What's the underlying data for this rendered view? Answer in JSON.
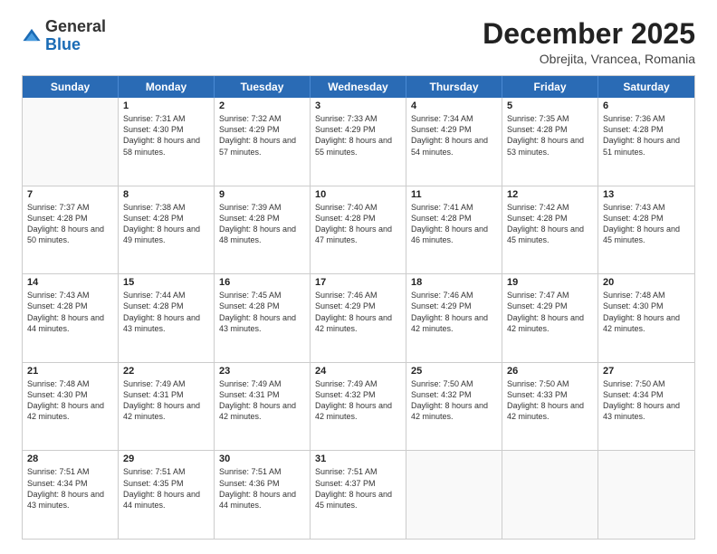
{
  "logo": {
    "general": "General",
    "blue": "Blue"
  },
  "header": {
    "month": "December 2025",
    "location": "Obrejita, Vrancea, Romania"
  },
  "days_of_week": [
    "Sunday",
    "Monday",
    "Tuesday",
    "Wednesday",
    "Thursday",
    "Friday",
    "Saturday"
  ],
  "weeks": [
    [
      {
        "day": "",
        "empty": true
      },
      {
        "day": "1",
        "sunrise": "7:31 AM",
        "sunset": "4:30 PM",
        "daylight": "8 hours and 58 minutes."
      },
      {
        "day": "2",
        "sunrise": "7:32 AM",
        "sunset": "4:29 PM",
        "daylight": "8 hours and 57 minutes."
      },
      {
        "day": "3",
        "sunrise": "7:33 AM",
        "sunset": "4:29 PM",
        "daylight": "8 hours and 55 minutes."
      },
      {
        "day": "4",
        "sunrise": "7:34 AM",
        "sunset": "4:29 PM",
        "daylight": "8 hours and 54 minutes."
      },
      {
        "day": "5",
        "sunrise": "7:35 AM",
        "sunset": "4:28 PM",
        "daylight": "8 hours and 53 minutes."
      },
      {
        "day": "6",
        "sunrise": "7:36 AM",
        "sunset": "4:28 PM",
        "daylight": "8 hours and 51 minutes."
      }
    ],
    [
      {
        "day": "7",
        "sunrise": "7:37 AM",
        "sunset": "4:28 PM",
        "daylight": "8 hours and 50 minutes."
      },
      {
        "day": "8",
        "sunrise": "7:38 AM",
        "sunset": "4:28 PM",
        "daylight": "8 hours and 49 minutes."
      },
      {
        "day": "9",
        "sunrise": "7:39 AM",
        "sunset": "4:28 PM",
        "daylight": "8 hours and 48 minutes."
      },
      {
        "day": "10",
        "sunrise": "7:40 AM",
        "sunset": "4:28 PM",
        "daylight": "8 hours and 47 minutes."
      },
      {
        "day": "11",
        "sunrise": "7:41 AM",
        "sunset": "4:28 PM",
        "daylight": "8 hours and 46 minutes."
      },
      {
        "day": "12",
        "sunrise": "7:42 AM",
        "sunset": "4:28 PM",
        "daylight": "8 hours and 45 minutes."
      },
      {
        "day": "13",
        "sunrise": "7:43 AM",
        "sunset": "4:28 PM",
        "daylight": "8 hours and 45 minutes."
      }
    ],
    [
      {
        "day": "14",
        "sunrise": "7:43 AM",
        "sunset": "4:28 PM",
        "daylight": "8 hours and 44 minutes."
      },
      {
        "day": "15",
        "sunrise": "7:44 AM",
        "sunset": "4:28 PM",
        "daylight": "8 hours and 43 minutes."
      },
      {
        "day": "16",
        "sunrise": "7:45 AM",
        "sunset": "4:28 PM",
        "daylight": "8 hours and 43 minutes."
      },
      {
        "day": "17",
        "sunrise": "7:46 AM",
        "sunset": "4:29 PM",
        "daylight": "8 hours and 42 minutes."
      },
      {
        "day": "18",
        "sunrise": "7:46 AM",
        "sunset": "4:29 PM",
        "daylight": "8 hours and 42 minutes."
      },
      {
        "day": "19",
        "sunrise": "7:47 AM",
        "sunset": "4:29 PM",
        "daylight": "8 hours and 42 minutes."
      },
      {
        "day": "20",
        "sunrise": "7:48 AM",
        "sunset": "4:30 PM",
        "daylight": "8 hours and 42 minutes."
      }
    ],
    [
      {
        "day": "21",
        "sunrise": "7:48 AM",
        "sunset": "4:30 PM",
        "daylight": "8 hours and 42 minutes."
      },
      {
        "day": "22",
        "sunrise": "7:49 AM",
        "sunset": "4:31 PM",
        "daylight": "8 hours and 42 minutes."
      },
      {
        "day": "23",
        "sunrise": "7:49 AM",
        "sunset": "4:31 PM",
        "daylight": "8 hours and 42 minutes."
      },
      {
        "day": "24",
        "sunrise": "7:49 AM",
        "sunset": "4:32 PM",
        "daylight": "8 hours and 42 minutes."
      },
      {
        "day": "25",
        "sunrise": "7:50 AM",
        "sunset": "4:32 PM",
        "daylight": "8 hours and 42 minutes."
      },
      {
        "day": "26",
        "sunrise": "7:50 AM",
        "sunset": "4:33 PM",
        "daylight": "8 hours and 42 minutes."
      },
      {
        "day": "27",
        "sunrise": "7:50 AM",
        "sunset": "4:34 PM",
        "daylight": "8 hours and 43 minutes."
      }
    ],
    [
      {
        "day": "28",
        "sunrise": "7:51 AM",
        "sunset": "4:34 PM",
        "daylight": "8 hours and 43 minutes."
      },
      {
        "day": "29",
        "sunrise": "7:51 AM",
        "sunset": "4:35 PM",
        "daylight": "8 hours and 44 minutes."
      },
      {
        "day": "30",
        "sunrise": "7:51 AM",
        "sunset": "4:36 PM",
        "daylight": "8 hours and 44 minutes."
      },
      {
        "day": "31",
        "sunrise": "7:51 AM",
        "sunset": "4:37 PM",
        "daylight": "8 hours and 45 minutes."
      },
      {
        "day": "",
        "empty": true
      },
      {
        "day": "",
        "empty": true
      },
      {
        "day": "",
        "empty": true
      }
    ]
  ],
  "labels": {
    "sunrise": "Sunrise:",
    "sunset": "Sunset:",
    "daylight": "Daylight:"
  }
}
